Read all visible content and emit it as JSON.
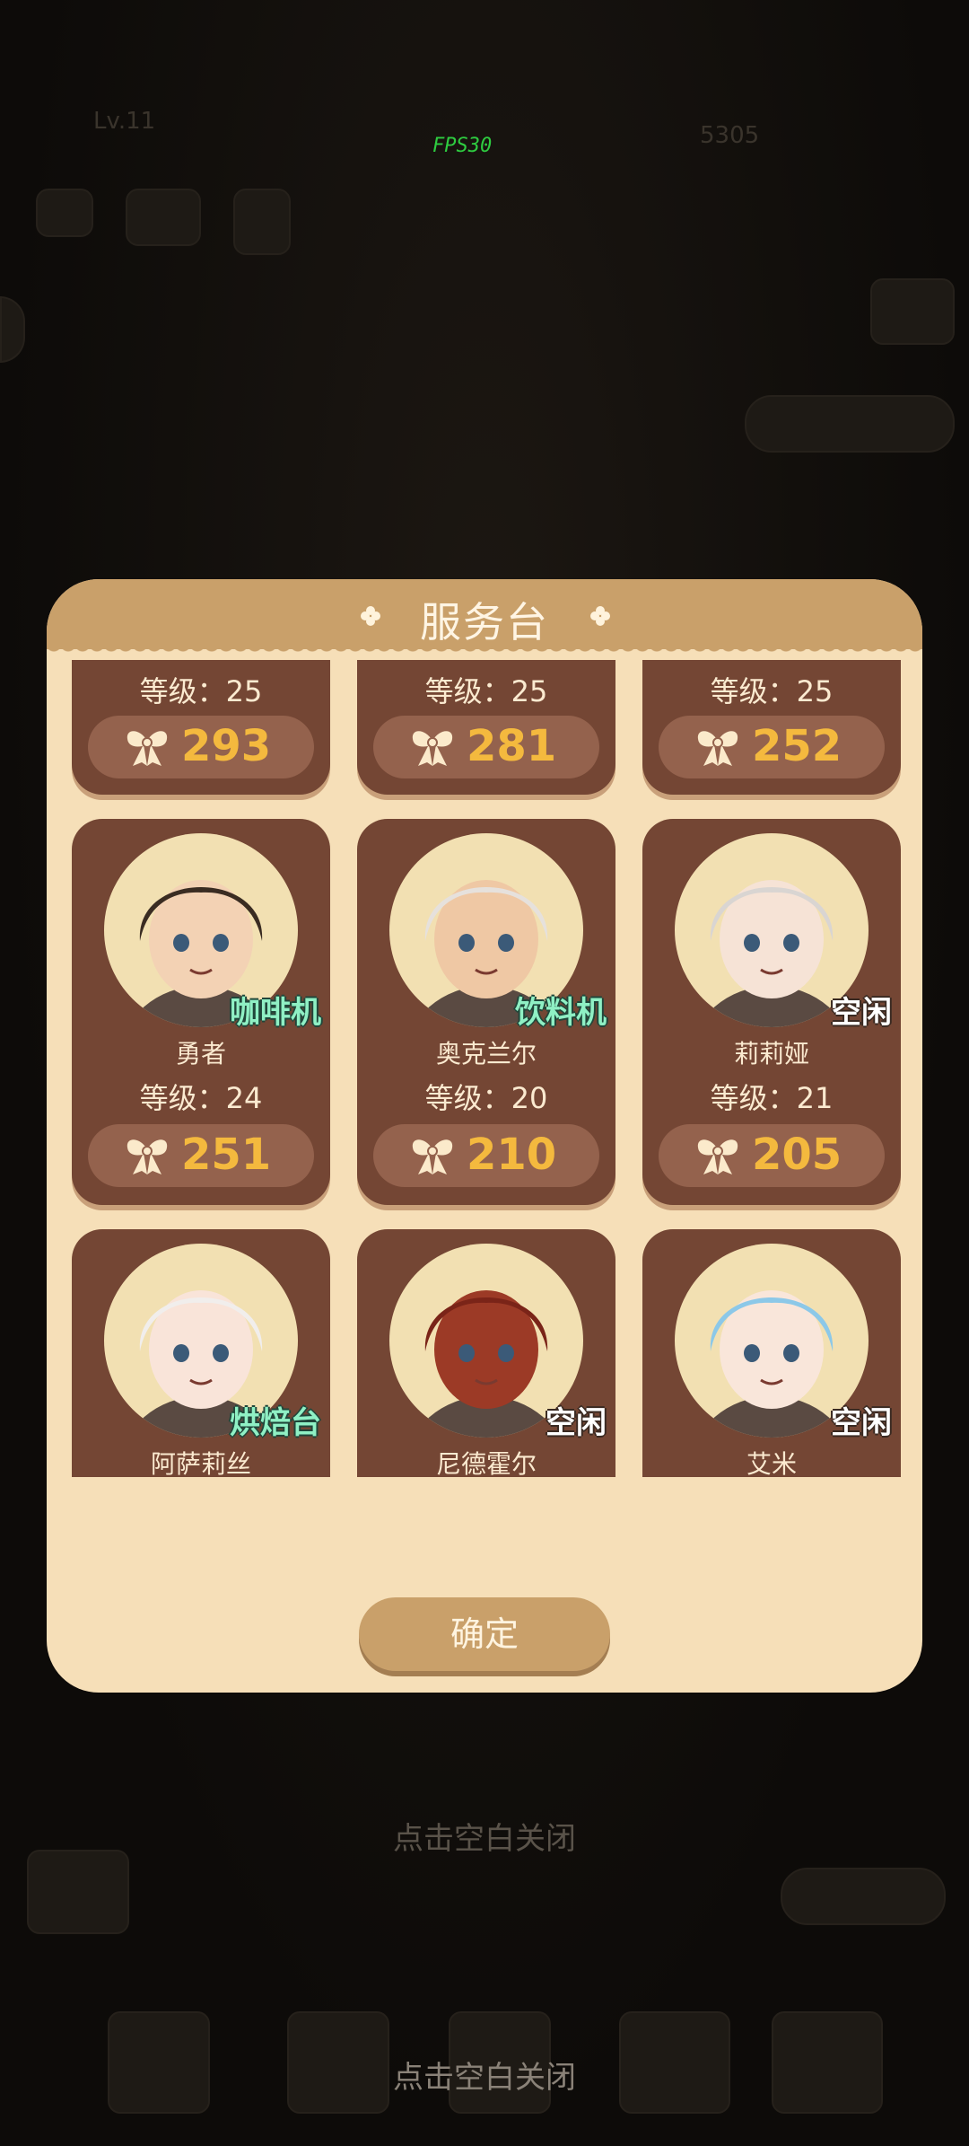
{
  "background": {
    "level_label": "Lv.11",
    "fps": "FPS30",
    "resource_value": "5305",
    "tap_to_close": "点击空白关闭"
  },
  "dialog": {
    "title": "服务台",
    "confirm_label": "确定",
    "level_prefix": "等级：",
    "top_row": [
      {
        "level": "25",
        "affinity": "293"
      },
      {
        "level": "25",
        "affinity": "281"
      },
      {
        "level": "25",
        "affinity": "252"
      }
    ],
    "staff": [
      {
        "name": "勇者",
        "status": "咖啡机",
        "level": "24",
        "affinity": "251",
        "idle": false,
        "hair": "#3a2c22",
        "skin": "#f3d2b4"
      },
      {
        "name": "奥克兰尔",
        "status": "饮料机",
        "level": "20",
        "affinity": "210",
        "idle": false,
        "hair": "#e6e1dc",
        "skin": "#efc8a4"
      },
      {
        "name": "莉莉娅",
        "status": "空闲",
        "level": "21",
        "affinity": "205",
        "idle": true,
        "hair": "#d9d5d2",
        "skin": "#f6e3d6"
      },
      {
        "name": "阿萨莉丝",
        "status": "烘焙台",
        "level": "",
        "affinity": "",
        "idle": false,
        "hair": "#f1eeec",
        "skin": "#f9e4d9"
      },
      {
        "name": "尼德霍尔",
        "status": "空闲",
        "level": "",
        "affinity": "",
        "idle": true,
        "hair": "#7a2418",
        "skin": "#9c3a26"
      },
      {
        "name": "艾米",
        "status": "空闲",
        "level": "",
        "affinity": "",
        "idle": true,
        "hair": "#8cc8e8",
        "skin": "#f9e6da"
      }
    ],
    "colors": {
      "panel": "#f6dfb8",
      "header": "#c9a06a",
      "card": "#744634",
      "pill": "#94624d",
      "affinity_text": "#f4b93e",
      "status_busy": "#8ff0c4"
    }
  }
}
